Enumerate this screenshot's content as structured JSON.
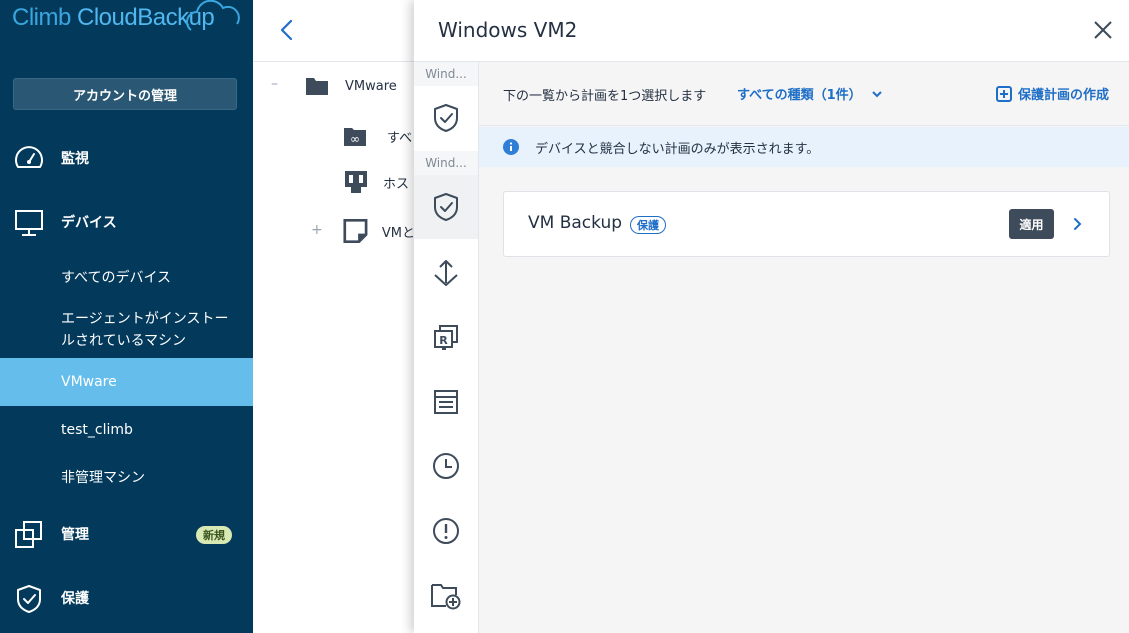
{
  "sidebar": {
    "logo_part1": "Climb ",
    "logo_part2": "CloudBackup",
    "account_button": "アカウントの管理",
    "nav": {
      "monitor": "監視",
      "devices": "デバイス",
      "manage": "管理",
      "protect": "保護"
    },
    "device_sub": {
      "all_devices": "すべてのデバイス",
      "agent_installed_line1": "エージェントがインストー",
      "agent_installed_line2": "ルされているマシン",
      "vmware": "VMware",
      "test_climb": "test_climb",
      "unmanaged": "非管理マシン"
    },
    "new_badge": "新規",
    "colors": {
      "bg": "#03395b",
      "active": "#65bdec"
    }
  },
  "tree": {
    "items": [
      {
        "label": "VMware",
        "expander": "–"
      },
      {
        "label": "すべ"
      },
      {
        "label": "ホス"
      },
      {
        "label": "VMと",
        "expander": "+"
      }
    ]
  },
  "drawer": {
    "title": "Windows VM2",
    "tab_captions": [
      "Wind...",
      "Wind..."
    ],
    "toolbar": {
      "instruction": "下の一覧から計画を1つ選択します",
      "filter": "すべての種類（1件）",
      "create": "保護計画の作成"
    },
    "info": "デバイスと競合しない計画のみが表示されます。",
    "plans": [
      {
        "name": "VM Backup",
        "tag": "保護",
        "apply": "適用"
      }
    ],
    "accent": "#1f6ec7"
  }
}
